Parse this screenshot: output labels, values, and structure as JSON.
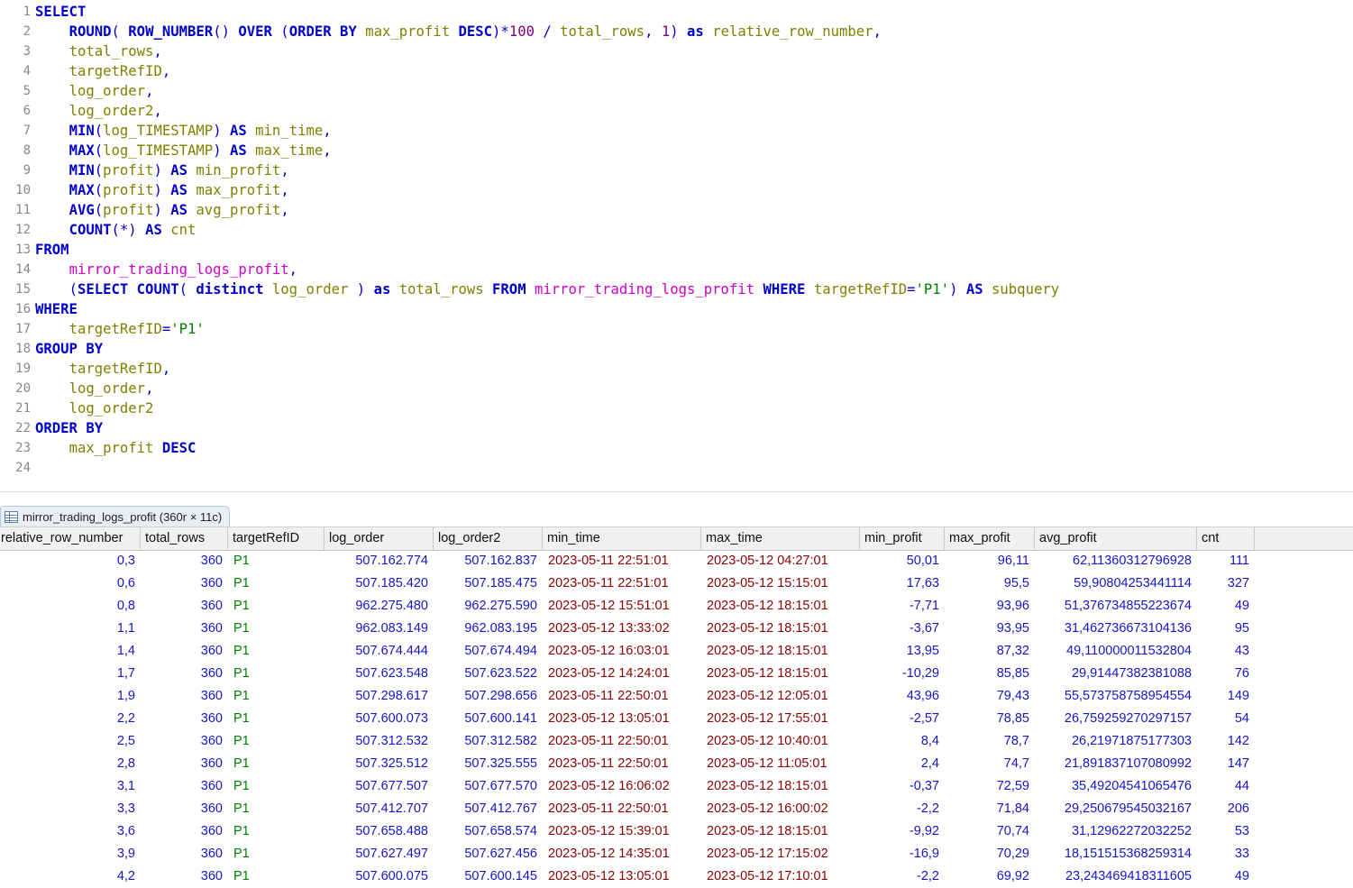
{
  "editor": {
    "lines": [
      {
        "n": "1",
        "t": [
          [
            "kw",
            "SELECT"
          ]
        ]
      },
      {
        "n": "2",
        "t": [
          [
            "pl",
            "    "
          ],
          [
            "kw",
            "ROUND"
          ],
          [
            "fn",
            "( "
          ],
          [
            "kw",
            "ROW_NUMBER"
          ],
          [
            "fn",
            "() "
          ],
          [
            "kw",
            "OVER"
          ],
          [
            "fn",
            " ("
          ],
          [
            "kw",
            "ORDER BY"
          ],
          [
            "pl",
            " "
          ],
          [
            "id",
            "max_profit"
          ],
          [
            "pl",
            " "
          ],
          [
            "kw",
            "DESC"
          ],
          [
            "fn",
            ")*"
          ],
          [
            "num",
            "100"
          ],
          [
            "fn",
            " / "
          ],
          [
            "id",
            "total_rows"
          ],
          [
            "fn",
            ", "
          ],
          [
            "num",
            "1"
          ],
          [
            "fn",
            ") "
          ],
          [
            "kw",
            "as"
          ],
          [
            "pl",
            " "
          ],
          [
            "id",
            "relative_row_number"
          ],
          [
            "fn",
            ","
          ]
        ]
      },
      {
        "n": "3",
        "t": [
          [
            "pl",
            "    "
          ],
          [
            "id",
            "total_rows"
          ],
          [
            "fn",
            ","
          ]
        ]
      },
      {
        "n": "4",
        "t": [
          [
            "pl",
            "    "
          ],
          [
            "id",
            "targetRefID"
          ],
          [
            "fn",
            ","
          ]
        ]
      },
      {
        "n": "5",
        "t": [
          [
            "pl",
            "    "
          ],
          [
            "id",
            "log_order"
          ],
          [
            "fn",
            ","
          ]
        ]
      },
      {
        "n": "6",
        "t": [
          [
            "pl",
            "    "
          ],
          [
            "id",
            "log_order2"
          ],
          [
            "fn",
            ","
          ]
        ]
      },
      {
        "n": "7",
        "t": [
          [
            "pl",
            "    "
          ],
          [
            "kw",
            "MIN"
          ],
          [
            "fn",
            "("
          ],
          [
            "id",
            "log_TIMESTAMP"
          ],
          [
            "fn",
            ") "
          ],
          [
            "kw",
            "AS"
          ],
          [
            "pl",
            " "
          ],
          [
            "id",
            "min_time"
          ],
          [
            "fn",
            ","
          ]
        ]
      },
      {
        "n": "8",
        "t": [
          [
            "pl",
            "    "
          ],
          [
            "kw",
            "MAX"
          ],
          [
            "fn",
            "("
          ],
          [
            "id",
            "log_TIMESTAMP"
          ],
          [
            "fn",
            ") "
          ],
          [
            "kw",
            "AS"
          ],
          [
            "pl",
            " "
          ],
          [
            "id",
            "max_time"
          ],
          [
            "fn",
            ","
          ]
        ]
      },
      {
        "n": "9",
        "t": [
          [
            "pl",
            "    "
          ],
          [
            "kw",
            "MIN"
          ],
          [
            "fn",
            "("
          ],
          [
            "id",
            "profit"
          ],
          [
            "fn",
            ") "
          ],
          [
            "kw",
            "AS"
          ],
          [
            "pl",
            " "
          ],
          [
            "id",
            "min_profit"
          ],
          [
            "fn",
            ","
          ]
        ]
      },
      {
        "n": "10",
        "t": [
          [
            "pl",
            "    "
          ],
          [
            "kw",
            "MAX"
          ],
          [
            "fn",
            "("
          ],
          [
            "id",
            "profit"
          ],
          [
            "fn",
            ") "
          ],
          [
            "kw",
            "AS"
          ],
          [
            "pl",
            " "
          ],
          [
            "id",
            "max_profit"
          ],
          [
            "fn",
            ","
          ]
        ]
      },
      {
        "n": "11",
        "t": [
          [
            "pl",
            "    "
          ],
          [
            "kw",
            "AVG"
          ],
          [
            "fn",
            "("
          ],
          [
            "id",
            "profit"
          ],
          [
            "fn",
            ") "
          ],
          [
            "kw",
            "AS"
          ],
          [
            "pl",
            " "
          ],
          [
            "id",
            "avg_profit"
          ],
          [
            "fn",
            ","
          ]
        ]
      },
      {
        "n": "12",
        "t": [
          [
            "pl",
            "    "
          ],
          [
            "kw",
            "COUNT"
          ],
          [
            "fn",
            "(*) "
          ],
          [
            "kw",
            "AS"
          ],
          [
            "pl",
            " "
          ],
          [
            "id",
            "cnt"
          ]
        ]
      },
      {
        "n": "13",
        "t": [
          [
            "kw",
            "FROM"
          ]
        ]
      },
      {
        "n": "14",
        "t": [
          [
            "pl",
            "    "
          ],
          [
            "tbl",
            "mirror_trading_logs_profit"
          ],
          [
            "fn",
            ","
          ]
        ]
      },
      {
        "n": "15",
        "t": [
          [
            "pl",
            "    "
          ],
          [
            "fn",
            "("
          ],
          [
            "kw",
            "SELECT COUNT"
          ],
          [
            "fn",
            "( "
          ],
          [
            "kw",
            "distinct"
          ],
          [
            "pl",
            " "
          ],
          [
            "id",
            "log_order"
          ],
          [
            "fn",
            " ) "
          ],
          [
            "kw",
            "as"
          ],
          [
            "pl",
            " "
          ],
          [
            "id",
            "total_rows"
          ],
          [
            "pl",
            " "
          ],
          [
            "kw",
            "FROM"
          ],
          [
            "pl",
            " "
          ],
          [
            "tbl",
            "mirror_trading_logs_profit"
          ],
          [
            "pl",
            " "
          ],
          [
            "kw",
            "WHERE"
          ],
          [
            "pl",
            " "
          ],
          [
            "id",
            "targetRefID"
          ],
          [
            "fn",
            "="
          ],
          [
            "str",
            "'P1'"
          ],
          [
            "fn",
            ") "
          ],
          [
            "kw",
            "AS"
          ],
          [
            "pl",
            " "
          ],
          [
            "id",
            "subquery"
          ]
        ]
      },
      {
        "n": "16",
        "t": [
          [
            "kw",
            "WHERE"
          ]
        ]
      },
      {
        "n": "17",
        "t": [
          [
            "pl",
            "    "
          ],
          [
            "id",
            "targetRefID"
          ],
          [
            "fn",
            "="
          ],
          [
            "str",
            "'P1'"
          ]
        ]
      },
      {
        "n": "18",
        "t": [
          [
            "kw",
            "GROUP BY"
          ]
        ]
      },
      {
        "n": "19",
        "t": [
          [
            "pl",
            "    "
          ],
          [
            "id",
            "targetRefID"
          ],
          [
            "fn",
            ","
          ]
        ]
      },
      {
        "n": "20",
        "t": [
          [
            "pl",
            "    "
          ],
          [
            "id",
            "log_order"
          ],
          [
            "fn",
            ","
          ]
        ]
      },
      {
        "n": "21",
        "t": [
          [
            "pl",
            "    "
          ],
          [
            "id",
            "log_order2"
          ]
        ]
      },
      {
        "n": "22",
        "t": [
          [
            "kw",
            "ORDER BY"
          ]
        ]
      },
      {
        "n": "23",
        "t": [
          [
            "pl",
            "    "
          ],
          [
            "id",
            "max_profit"
          ],
          [
            "pl",
            " "
          ],
          [
            "kw",
            "DESC"
          ]
        ]
      },
      {
        "n": "24",
        "t": []
      }
    ]
  },
  "result_tab": {
    "label": "mirror_trading_logs_profit (360r × 11c)",
    "icon": "table-grid-icon"
  },
  "grid": {
    "columns": [
      "relative_row_number",
      "total_rows",
      "targetRefID",
      "log_order",
      "log_order2",
      "min_time",
      "max_time",
      "min_profit",
      "max_profit",
      "avg_profit",
      "cnt"
    ],
    "rows": [
      [
        "0,3",
        "360",
        "P1",
        "507.162.774",
        "507.162.837",
        "2023-05-11 22:51:01",
        "2023-05-12 04:27:01",
        "50,01",
        "96,11",
        "62,11360312796928",
        "111"
      ],
      [
        "0,6",
        "360",
        "P1",
        "507.185.420",
        "507.185.475",
        "2023-05-11 22:51:01",
        "2023-05-12 15:15:01",
        "17,63",
        "95,5",
        "59,90804253441114",
        "327"
      ],
      [
        "0,8",
        "360",
        "P1",
        "962.275.480",
        "962.275.590",
        "2023-05-12 15:51:01",
        "2023-05-12 18:15:01",
        "-7,71",
        "93,96",
        "51,376734855223674",
        "49"
      ],
      [
        "1,1",
        "360",
        "P1",
        "962.083.149",
        "962.083.195",
        "2023-05-12 13:33:02",
        "2023-05-12 18:15:01",
        "-3,67",
        "93,95",
        "31,462736673104136",
        "95"
      ],
      [
        "1,4",
        "360",
        "P1",
        "507.674.444",
        "507.674.494",
        "2023-05-12 16:03:01",
        "2023-05-12 18:15:01",
        "13,95",
        "87,32",
        "49,110000011532804",
        "43"
      ],
      [
        "1,7",
        "360",
        "P1",
        "507.623.548",
        "507.623.522",
        "2023-05-12 14:24:01",
        "2023-05-12 18:15:01",
        "-10,29",
        "85,85",
        "29,91447382381088",
        "76"
      ],
      [
        "1,9",
        "360",
        "P1",
        "507.298.617",
        "507.298.656",
        "2023-05-11 22:50:01",
        "2023-05-12 12:05:01",
        "43,96",
        "79,43",
        "55,573758758954554",
        "149"
      ],
      [
        "2,2",
        "360",
        "P1",
        "507.600.073",
        "507.600.141",
        "2023-05-12 13:05:01",
        "2023-05-12 17:55:01",
        "-2,57",
        "78,85",
        "26,759259270297157",
        "54"
      ],
      [
        "2,5",
        "360",
        "P1",
        "507.312.532",
        "507.312.582",
        "2023-05-11 22:50:01",
        "2023-05-12 10:40:01",
        "8,4",
        "78,7",
        "26,21971875177303",
        "142"
      ],
      [
        "2,8",
        "360",
        "P1",
        "507.325.512",
        "507.325.555",
        "2023-05-11 22:50:01",
        "2023-05-12 11:05:01",
        "2,4",
        "74,7",
        "21,891837107080992",
        "147"
      ],
      [
        "3,1",
        "360",
        "P1",
        "507.677.507",
        "507.677.570",
        "2023-05-12 16:06:02",
        "2023-05-12 18:15:01",
        "-0,37",
        "72,59",
        "35,49204541065476",
        "44"
      ],
      [
        "3,3",
        "360",
        "P1",
        "507.412.707",
        "507.412.767",
        "2023-05-11 22:50:01",
        "2023-05-12 16:00:02",
        "-2,2",
        "71,84",
        "29,250679545032167",
        "206"
      ],
      [
        "3,6",
        "360",
        "P1",
        "507.658.488",
        "507.658.574",
        "2023-05-12 15:39:01",
        "2023-05-12 18:15:01",
        "-9,92",
        "70,74",
        "31,12962272032252",
        "53"
      ],
      [
        "3,9",
        "360",
        "P1",
        "507.627.497",
        "507.627.456",
        "2023-05-12 14:35:01",
        "2023-05-12 17:15:02",
        "-16,9",
        "70,29",
        "18,151515368259314",
        "33"
      ],
      [
        "4,2",
        "360",
        "P1",
        "507.600.075",
        "507.600.145",
        "2023-05-12 13:05:01",
        "2023-05-12 17:10:01",
        "-2,2",
        "69,92",
        "23,243469418311605",
        "49"
      ]
    ]
  },
  "colors": {
    "keyword": "#0000cc",
    "identifier": "#808000",
    "table": "#cc00cc",
    "string": "#008000",
    "number_value": "#1515c8",
    "date_value": "#8b0000",
    "text_value": "#008000"
  }
}
